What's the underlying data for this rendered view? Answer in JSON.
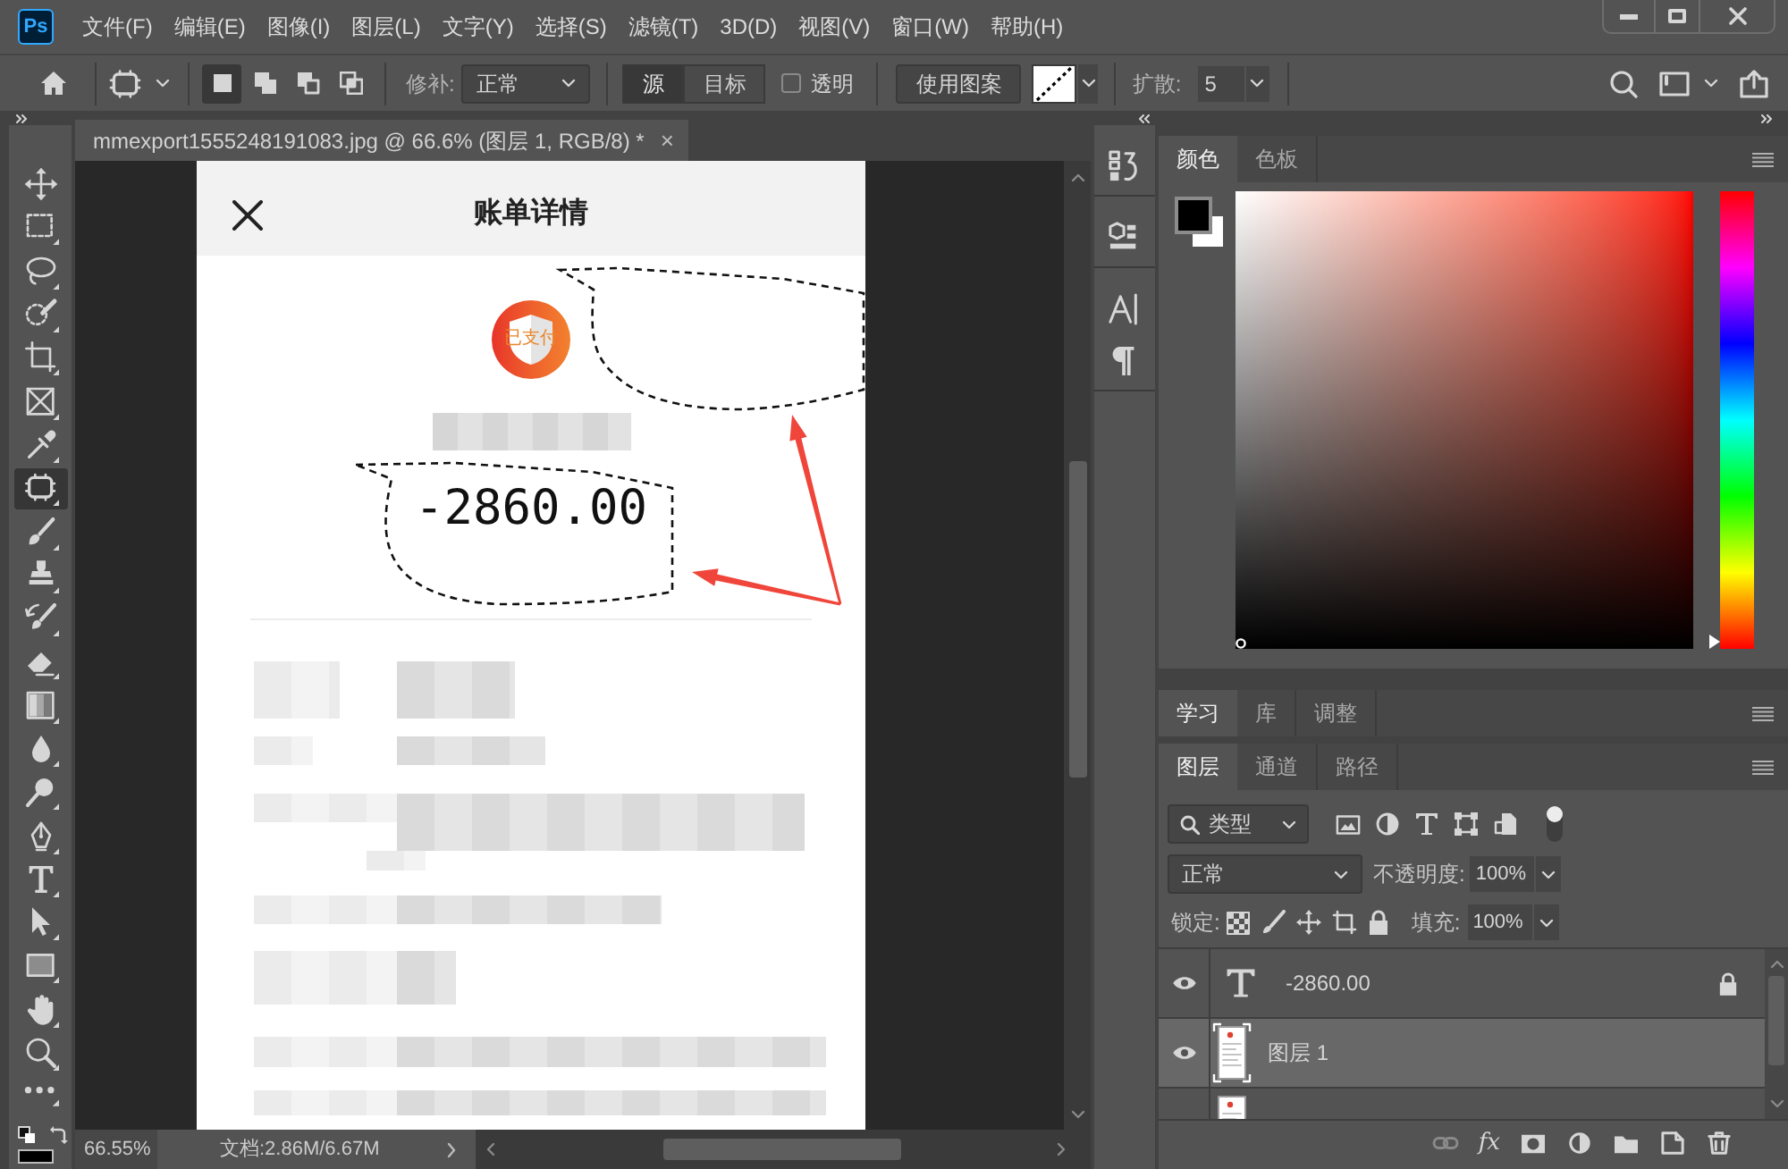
{
  "menu_bar": {
    "logo": "Ps",
    "items": [
      "文件(F)",
      "编辑(E)",
      "图像(I)",
      "图层(L)",
      "文字(Y)",
      "选择(S)",
      "滤镜(T)",
      "3D(D)",
      "视图(V)",
      "窗口(W)",
      "帮助(H)"
    ]
  },
  "options_bar": {
    "modes": [
      {
        "kind": "new",
        "selected": true
      },
      {
        "kind": "add",
        "selected": false
      },
      {
        "kind": "subtract",
        "selected": false
      },
      {
        "kind": "intersect",
        "selected": false
      }
    ],
    "patch_label": "修补:",
    "patch_mode": "正常",
    "source_target": [
      {
        "label": "源",
        "selected": true
      },
      {
        "label": "目标",
        "selected": false
      }
    ],
    "transparent": {
      "label": "透明",
      "checked": false
    },
    "pattern_button": "使用图案",
    "diffusion_label": "扩散:",
    "diffusion": "5"
  },
  "tools": [
    {
      "kind": "move",
      "selected": false
    },
    {
      "kind": "marquee",
      "selected": false
    },
    {
      "kind": "lasso",
      "selected": false
    },
    {
      "kind": "quickselect",
      "selected": false
    },
    {
      "kind": "crop",
      "selected": false
    },
    {
      "kind": "frame",
      "selected": false
    },
    {
      "kind": "eyedropper",
      "selected": false
    },
    {
      "kind": "patch",
      "selected": true
    },
    {
      "kind": "brush",
      "selected": false
    },
    {
      "kind": "stamp",
      "selected": false
    },
    {
      "kind": "historybrush",
      "selected": false
    },
    {
      "kind": "eraser",
      "selected": false
    },
    {
      "kind": "gradient",
      "selected": false
    },
    {
      "kind": "blur",
      "selected": false
    },
    {
      "kind": "dodge",
      "selected": false
    },
    {
      "kind": "pen",
      "selected": false
    },
    {
      "kind": "type",
      "selected": false
    },
    {
      "kind": "pathselect",
      "selected": false
    },
    {
      "kind": "rectangle",
      "selected": false
    },
    {
      "kind": "hand",
      "selected": false
    },
    {
      "kind": "zoom",
      "selected": false
    },
    {
      "kind": "more",
      "selected": false
    }
  ],
  "document": {
    "tab_title": "mmexport1555248191083.jpg @ 66.6% (图层 1, RGB/8) *",
    "tab_close": "×",
    "image": {
      "title": "账单详情",
      "badge": "已支付",
      "amount": "-2860.00"
    }
  },
  "status_bar": {
    "zoom": "66.55%",
    "doc_size": "文档:2.86M/6.67M"
  },
  "dock": {
    "groups": [
      {
        "items": [
          {
            "kind": "history"
          }
        ]
      },
      {
        "items": [
          {
            "kind": "properties"
          }
        ]
      },
      {
        "items": [
          {
            "kind": "character"
          },
          {
            "kind": "paragraph"
          }
        ]
      }
    ]
  },
  "color_panel": {
    "tabs": [
      {
        "label": "颜色",
        "selected": true
      },
      {
        "label": "色板",
        "selected": false
      }
    ],
    "hue": {
      "level": 0
    }
  },
  "learn_panel": {
    "tabs": [
      {
        "label": "学习",
        "selected": true
      },
      {
        "label": "库",
        "selected": false
      },
      {
        "label": "调整",
        "selected": false
      }
    ]
  },
  "layers_panel": {
    "tabs": [
      {
        "label": "图层",
        "selected": true
      },
      {
        "label": "通道",
        "selected": false
      },
      {
        "label": "路径",
        "selected": false
      }
    ],
    "filter": "类型",
    "filter_on": true,
    "blend_mode": "正常",
    "opacity_label": "不透明度:",
    "opacity": "100%",
    "lock_label": "锁定:",
    "fill_label": "填充:",
    "fill": "100%",
    "layers": [
      {
        "kind": "text",
        "name": "-2860.00",
        "visible": true,
        "locked": true,
        "selected": false
      },
      {
        "kind": "image",
        "name": "图层 1",
        "visible": true,
        "locked": false,
        "selected": true
      },
      {
        "kind": "image",
        "selected": false
      }
    ],
    "footer": [
      {
        "kind": "link"
      },
      {
        "kind": "fx",
        "label": "fx"
      },
      {
        "kind": "mask"
      },
      {
        "kind": "adjustment"
      },
      {
        "kind": "group"
      },
      {
        "kind": "new"
      },
      {
        "kind": "delete"
      }
    ]
  }
}
